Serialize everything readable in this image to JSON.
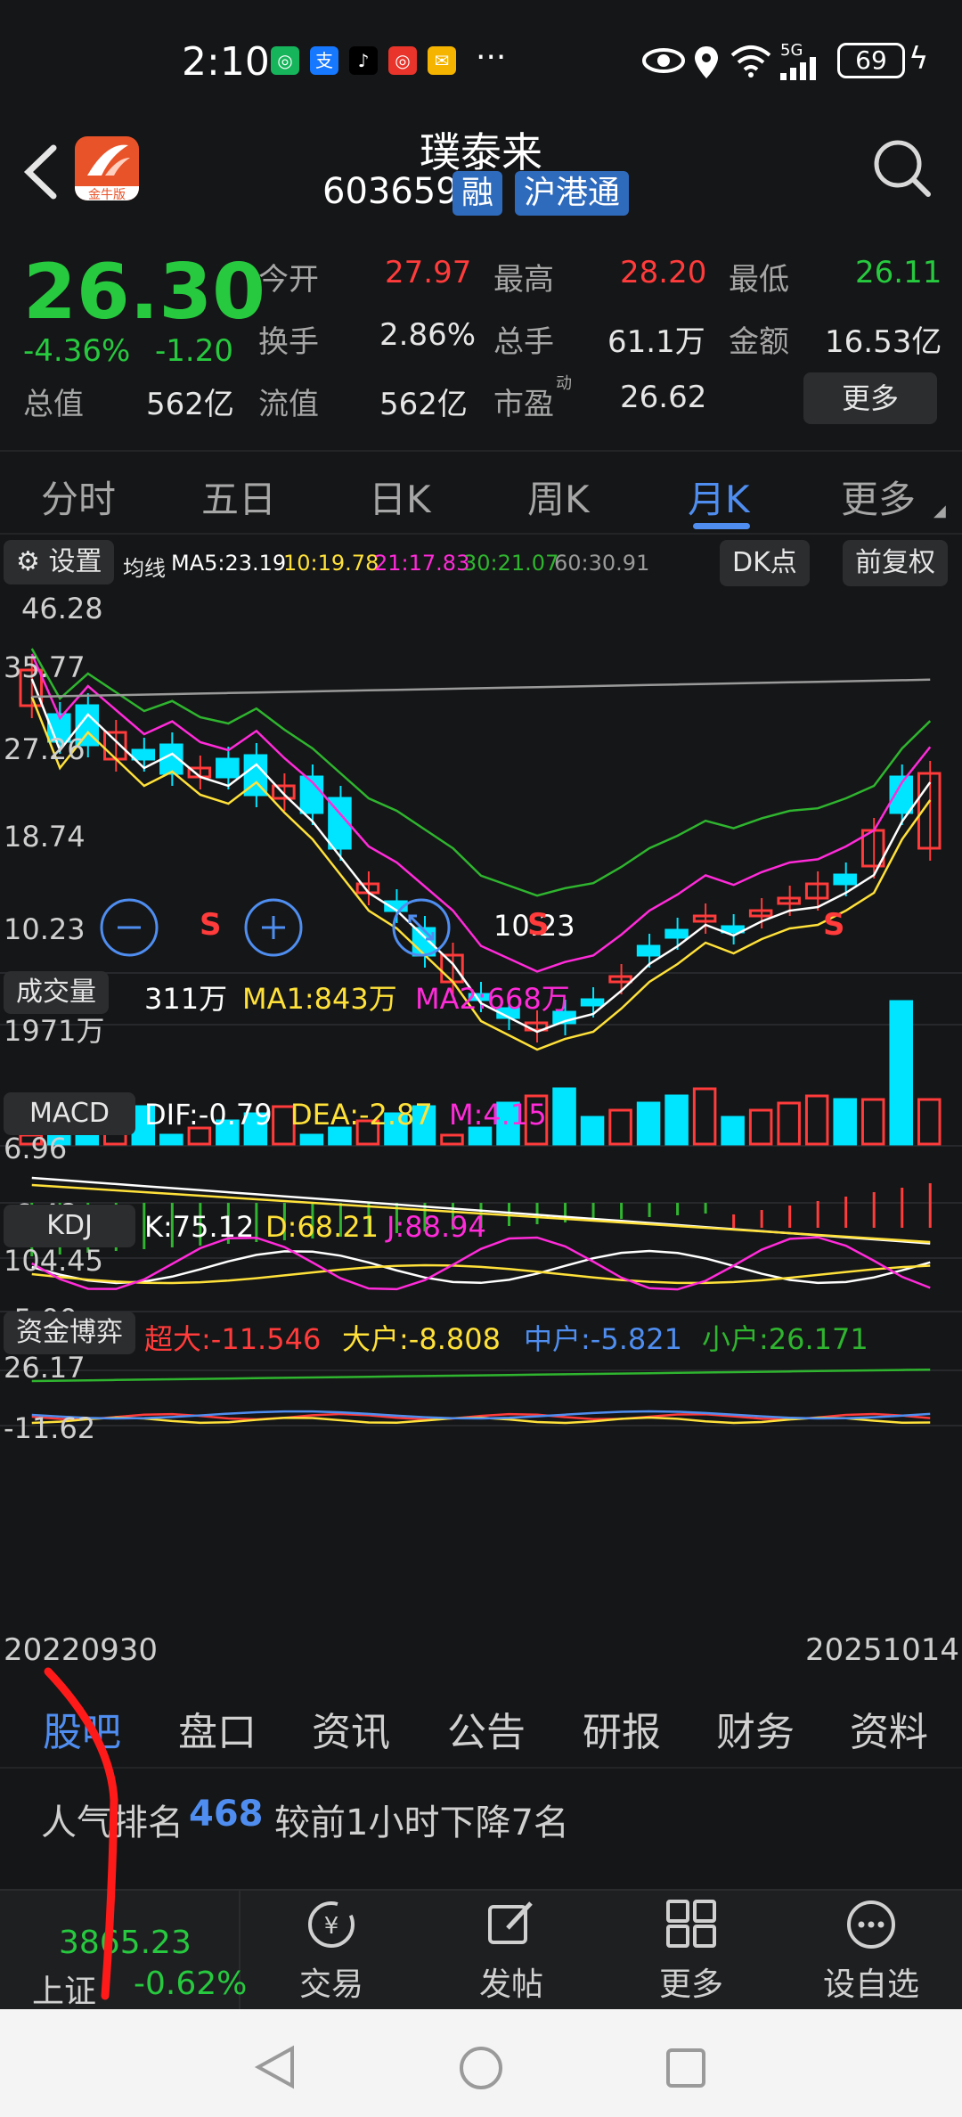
{
  "status_bar": {
    "time": "2:10",
    "battery": "69",
    "network": "5G"
  },
  "header": {
    "title": "璞泰来",
    "code": "603659",
    "badge_rong": "融",
    "badge_hk": "沪港通",
    "logo_text": "金牛版"
  },
  "quote": {
    "price": "26.30",
    "change_pct": "-4.36%",
    "change": "-1.20",
    "open_label": "今开",
    "open": "27.97",
    "high_label": "最高",
    "high": "28.20",
    "low_label": "最低",
    "low": "26.11",
    "turnover_label": "换手",
    "turnover": "2.86%",
    "volume_label": "总手",
    "volume": "61.1万",
    "amount_label": "金额",
    "amount": "16.53亿",
    "mcap_label": "总值",
    "mcap": "562亿",
    "float_label": "流值",
    "float": "562亿",
    "pe_label": "市盈",
    "pe_sup": "动",
    "pe": "26.62",
    "more_label": "更多"
  },
  "tabs": [
    "分时",
    "五日",
    "日K",
    "周K",
    "月K",
    "更多"
  ],
  "kline": {
    "settings_label": "设置",
    "ma_label": "均线",
    "ma5": "MA5:23.19",
    "ma10": "10:19.78",
    "ma21": "21:17.83",
    "ma30": "30:21.07",
    "ma60": "60:30.91",
    "dk_label": "DK点",
    "fq_label": "前复权",
    "max_price": "46.28",
    "y_ticks": [
      "35.77",
      "27.26",
      "18.74",
      "10.23"
    ],
    "low_marker": "10.23",
    "s_label": "S"
  },
  "volume": {
    "label": "成交量",
    "value": "311万",
    "ma1": "MA1:843万",
    "ma2": "MA2:668万",
    "y_max": "1971万"
  },
  "macd": {
    "label": "MACD",
    "dif": "DIF:-0.79",
    "dea": "DEA:-2.87",
    "m": "M:4.15",
    "y_top": "6.96",
    "y_bottom": "-6.48"
  },
  "kdj": {
    "label": "KDJ",
    "k": "K:75.12",
    "d": "D:68.21",
    "j": "J:88.94",
    "y_top": "104.45",
    "y_bottom": "-5.00"
  },
  "fund": {
    "label": "资金博弈",
    "super": "超大:-11.546",
    "large": "大户:-8.808",
    "mid": "中户:-5.821",
    "small": "小户:26.171",
    "y_top": "26.17",
    "y_bottom": "-11.62"
  },
  "date_range": {
    "start": "20220930",
    "end": "20251014"
  },
  "subtabs": [
    "股吧",
    "盘口",
    "资讯",
    "公告",
    "研报",
    "财务",
    "资料"
  ],
  "rank": {
    "label": "人气排名",
    "value": "468",
    "note": "较前1小时下降7名"
  },
  "bottom_bar": {
    "index_value": "3865.23",
    "index_name": "上证",
    "index_change": "-0.62%",
    "trade": "交易",
    "post": "发帖",
    "more": "更多",
    "watch": "设自选"
  },
  "colors": {
    "up": "#ff3b3b",
    "down": "#00e5ff",
    "accent": "#4f8ef0",
    "ma5": "#ffffff",
    "ma10": "#ffe13a",
    "ma21": "#ff2bd9",
    "ma30": "#2fb52f",
    "ma60": "#9a9a9a"
  }
}
